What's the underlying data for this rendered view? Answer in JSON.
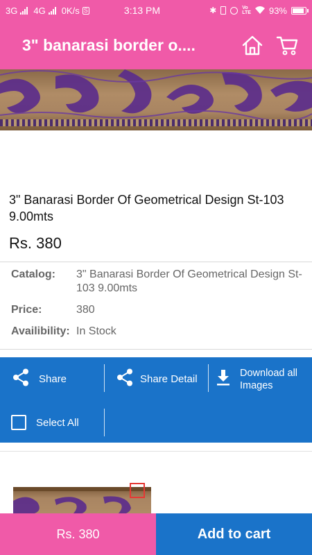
{
  "status_bar": {
    "net1": "3G",
    "net2": "4G",
    "speed": "0K/s",
    "s_badge": "S",
    "time": "3:13 PM",
    "battery": "93%"
  },
  "app_bar": {
    "title": "3\" banarasi border o....",
    "home_icon": "home-icon",
    "cart_icon": "cart-icon"
  },
  "product": {
    "title": "3\" Banarasi Border Of Geometrical Design St-103 9.00mts",
    "price": "Rs. 380"
  },
  "details": {
    "catalog_label": "Catalog:",
    "catalog_value": "3\" Banarasi Border Of Geometrical Design St-103 9.00mts",
    "price_label": "Price:",
    "price_value": "380",
    "availability_label": "Availibility:",
    "availability_value": "In Stock"
  },
  "actions": {
    "share": "Share",
    "share_detail": "Share Detail",
    "download_line1": "Download all",
    "download_line2": "Images",
    "select_all": "Select All"
  },
  "bottom_bar": {
    "price": "Rs. 380",
    "add_to_cart": "Add to cart"
  },
  "colors": {
    "primary_pink": "#f05aa8",
    "action_blue": "#1a73c9"
  }
}
